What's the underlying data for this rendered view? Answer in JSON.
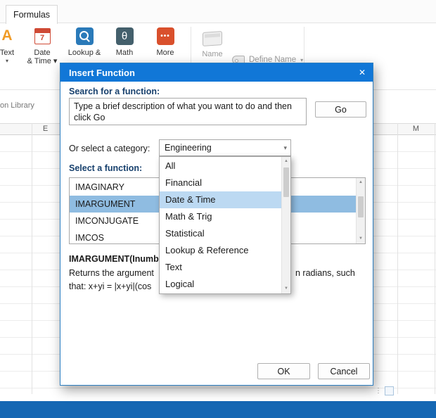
{
  "colors": {
    "accent_blue": "#1177d7",
    "status_bar_blue": "#1567b3",
    "list_selection": "#8fbce1",
    "dropdown_highlight": "#bcd9f2"
  },
  "ribbon": {
    "tab_label": "Formulas",
    "group_label": "on Library",
    "text_button": {
      "glyph": "A",
      "label": "Text",
      "arrow": "▾"
    },
    "date_button": {
      "glyph": "7",
      "label_line1": "Date",
      "label_line2": "& Time ▾"
    },
    "lookup_button": {
      "label": "Lookup &"
    },
    "math_button": {
      "glyph": "θ",
      "label": "Math"
    },
    "more_button": {
      "glyph": "•••",
      "label": "More"
    },
    "name_button": {
      "label": "Name"
    },
    "define_name_button": {
      "label": "Define Name",
      "arrow": "▾"
    }
  },
  "sheet": {
    "col_e": "E",
    "col_m": "M",
    "overflow_glyph": "⋮"
  },
  "dialog": {
    "title": "Insert Function",
    "close_glyph": "✕",
    "search_label": "Search for a function:",
    "search_text": "Type a brief description of what you want to do and then click Go",
    "go_label": "Go",
    "category_label": "Or select a category:",
    "category_value": "Engineering",
    "arrow_glyph": "▾",
    "select_label": "Select a function:",
    "functions": [
      "IMAGINARY",
      "IMARGUMENT",
      "IMCONJUGATE",
      "IMCOS"
    ],
    "categories": [
      "All",
      "Financial",
      "Date & Time",
      "Math & Trig",
      "Statistical",
      "Lookup & Reference",
      "Text",
      "Logical"
    ],
    "signature": "IMARGUMENT(Inumb",
    "desc_left": "Returns the argument",
    "desc_right": "n radians, such",
    "desc_line2": "that: x+yi = |x+yi|(cos",
    "ok_label": "OK",
    "cancel_label": "Cancel",
    "scroll_up": "▲",
    "scroll_down": "▼"
  }
}
